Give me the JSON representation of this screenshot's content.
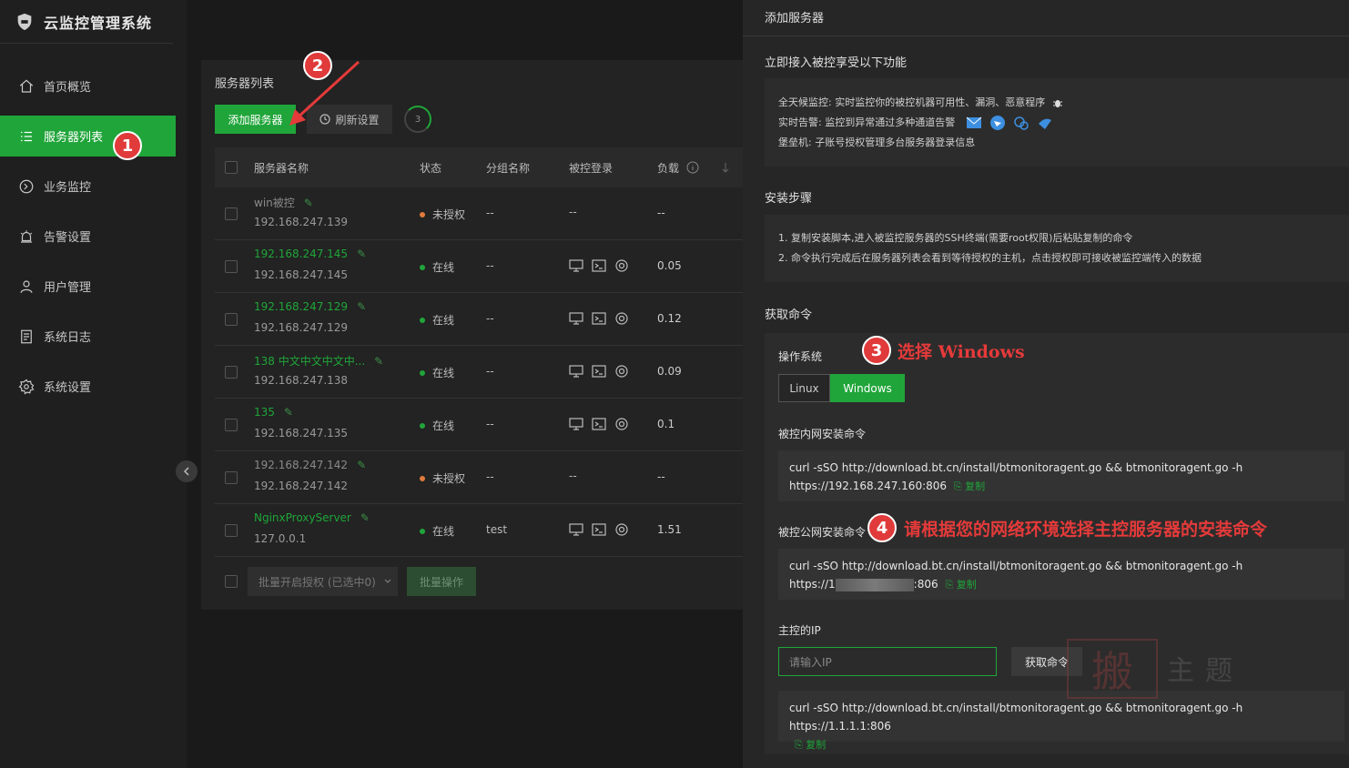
{
  "app": {
    "title": "云监控管理系统"
  },
  "sidebar": {
    "items": [
      {
        "label": "首页概览",
        "icon": "home-icon"
      },
      {
        "label": "服务器列表",
        "icon": "list-icon",
        "active": true
      },
      {
        "label": "业务监控",
        "icon": "monitor-icon"
      },
      {
        "label": "告警设置",
        "icon": "alarm-icon"
      },
      {
        "label": "用户管理",
        "icon": "user-icon"
      },
      {
        "label": "系统日志",
        "icon": "log-icon"
      },
      {
        "label": "系统设置",
        "icon": "gear-icon"
      }
    ]
  },
  "main": {
    "title": "服务器列表",
    "add_label": "添加服务器",
    "refresh_label": "刷新设置",
    "count": "3",
    "columns": {
      "name": "服务器名称",
      "status": "状态",
      "group": "分组名称",
      "control": "被控登录",
      "load": "负载"
    },
    "rows": [
      {
        "name": "win被控",
        "ip": "192.168.247.139",
        "status": "未授权",
        "group": "--",
        "control": "--",
        "load": "--",
        "online": false
      },
      {
        "name": "192.168.247.145",
        "ip": "192.168.247.145",
        "status": "在线",
        "group": "--",
        "control": "",
        "load": "0.05",
        "online": true
      },
      {
        "name": "192.168.247.129",
        "ip": "192.168.247.129",
        "status": "在线",
        "group": "--",
        "control": "",
        "load": "0.12",
        "online": true
      },
      {
        "name": "138 中文中文中文中...",
        "ip": "192.168.247.138",
        "status": "在线",
        "group": "--",
        "control": "",
        "load": "0.09",
        "online": true
      },
      {
        "name": "135",
        "ip": "192.168.247.135",
        "status": "在线",
        "group": "--",
        "control": "",
        "load": "0.1",
        "online": true
      },
      {
        "name": "192.168.247.142",
        "ip": "192.168.247.142",
        "status": "未授权",
        "group": "--",
        "control": "--",
        "load": "--",
        "online": false
      },
      {
        "name": "NginxProxyServer",
        "ip": "127.0.0.1",
        "status": "在线",
        "group": "test",
        "control": "",
        "load": "1.51",
        "online": true
      }
    ],
    "batch_select": "批量开启授权 (已选中0)",
    "batch_action": "批量操作"
  },
  "drawer": {
    "title": "添加服务器",
    "features_title": "立即接入被控享受以下功能",
    "features": [
      "全天候监控: 实时监控你的被控机器可用性、漏洞、恶意程序",
      "实时告警: 监控到异常通过多种通道告警",
      "堡垒机: 子账号授权管理多台服务器登录信息"
    ],
    "steps_title": "安装步骤",
    "steps": [
      "1. 复制安装脚本,进入被监控服务器的SSH终端(需要root权限)后粘贴复制的命令",
      "2. 命令执行完成后在服务器列表会看到等待授权的主机，点击授权即可接收被监控端传入的数据"
    ],
    "cmd_title": "获取命令",
    "os_label": "操作系统",
    "os_options": [
      "Linux",
      "Windows"
    ],
    "os_selected": "Windows",
    "intranet_label": "被控内网安装命令",
    "intranet_cmd_1": "curl -sSO http://download.bt.cn/install/btmonitoragent.go && btmonitoragent.go -h",
    "intranet_cmd_2": "https://192.168.247.160:806",
    "public_label": "被控公网安装命令",
    "public_cmd_1": "curl -sSO http://download.bt.cn/install/btmonitoragent.go && btmonitoragent.go -h",
    "public_cmd_prefix": "https://1",
    "public_cmd_suffix": ":806",
    "master_ip_label": "主控的IP",
    "ip_placeholder": "请输入IP",
    "get_cmd_label": "获取命令",
    "result_cmd": "curl -sSO http://download.bt.cn/install/btmonitoragent.go && btmonitoragent.go -h https://1.1.1.1:806",
    "copy_label": "复制"
  },
  "annotations": {
    "n1": "1",
    "n2": "2",
    "n3": "3",
    "n4": "4",
    "text3": "选择 Windows",
    "text4": "请根据您的网络环境选择主控服务器的安装命令"
  },
  "watermark": {
    "glyph": "搬",
    "text": "主题"
  },
  "colors": {
    "accent": "#20a53a",
    "annotation": "#e53a3a",
    "unauth": "#e07a3a"
  }
}
